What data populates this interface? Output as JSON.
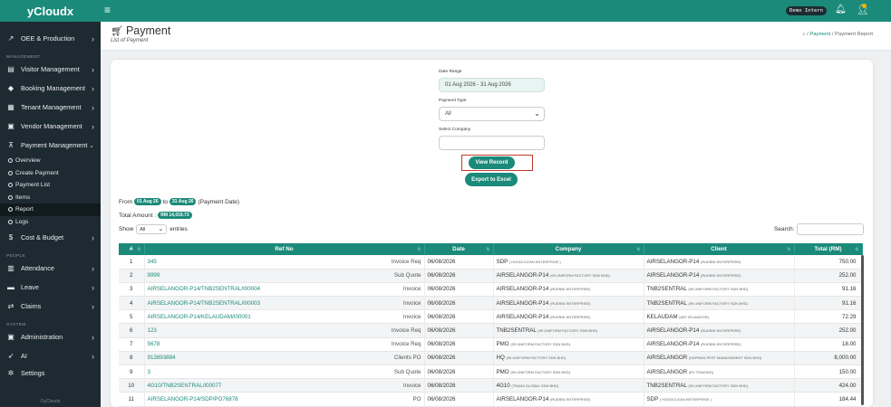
{
  "sidebar": {
    "brand": "yCloudx",
    "items": [
      {
        "label": "OEE & Production"
      },
      {
        "label": "Visitor Management"
      },
      {
        "label": "Booking Management"
      },
      {
        "label": "Tenant Management"
      },
      {
        "label": "Vendor Management"
      },
      {
        "label": "Payment Management"
      },
      {
        "label": "Cost & Budget"
      },
      {
        "label": "Attendance"
      },
      {
        "label": "Leave"
      },
      {
        "label": "Claims"
      },
      {
        "label": "Administration"
      },
      {
        "label": "AI"
      },
      {
        "label": "Settings"
      }
    ],
    "sections": {
      "management": "MANAGEMENT",
      "people": "PEOPLE",
      "system": "SYSTEM"
    },
    "payment_sub": [
      {
        "label": "Overview"
      },
      {
        "label": "Create Payment"
      },
      {
        "label": "Payment List"
      },
      {
        "label": "Items"
      },
      {
        "label": "Report"
      },
      {
        "label": "Logs"
      }
    ],
    "footer": "©yCloudx"
  },
  "topbar": {
    "env_badge": "Demo Intern"
  },
  "header": {
    "title": "Payment",
    "subtitle": "List of Payment",
    "breadcrumb": {
      "sep": "/",
      "payment": "Payment",
      "current": "Payment Report"
    }
  },
  "filters": {
    "date_range_label": "Date Range",
    "date_range_value": "01 Aug 2026 - 31 Aug 2026",
    "payment_type_label": "Payment Type",
    "payment_type_value": "All",
    "company_label": "Select Company",
    "company_value": "",
    "view_btn": "View Record",
    "export_btn": "Export to Excel"
  },
  "summary": {
    "from_label": "From",
    "from_date": "01 Aug 26",
    "to_label": "to",
    "to_date": "31 Aug 26",
    "suffix": "(Payment Date)",
    "total_label": "Total Amount :",
    "total_value": "RM 14,019.73"
  },
  "list_controls": {
    "show_label": "Show",
    "entries_value": "All",
    "entries_label": "entries",
    "search_label": "Search:"
  },
  "table": {
    "headers": [
      "#",
      "Ref No",
      "Date",
      "Company",
      "Client",
      "Total (RM)"
    ],
    "rows": [
      {
        "no": "1",
        "ref": "345",
        "type": "Invoice Req",
        "date": "06/08/2026",
        "company": "SDP",
        "company_sub": "( HOODCLEAN ENTERPRISE )",
        "client": "AIRSELANGOR-P14",
        "client_sub": "(RUEBNI ENTERPRISE)",
        "total": "750.00"
      },
      {
        "no": "2",
        "ref": "9999",
        "type": "Sub Quote",
        "date": "06/08/2026",
        "company": "AIRSELANGOR-P14",
        "company_sub": "(99 UNIFORM FACTORY SDN BHD)",
        "client": "AIRSELANGOR-P14",
        "client_sub": "(RUEBNI ENTERPRISE)",
        "total": "252.00"
      },
      {
        "no": "3",
        "ref": "AIRSELANGOR-P14/TNB2SENTRAL/I00004",
        "type": "Invoice",
        "date": "06/08/2026",
        "company": "AIRSELANGOR-P14",
        "company_sub": "(RUEBNI ENTERPRISE)",
        "client": "TNB2SENTRAL",
        "client_sub": "(99 UNIFORM FACTORY SDN BHD)",
        "total": "91.16"
      },
      {
        "no": "4",
        "ref": "AIRSELANGOR-P14/TNB2SENTRAL/I00003",
        "type": "Invoice",
        "date": "06/08/2026",
        "company": "AIRSELANGOR-P14",
        "company_sub": "(RUEBNI ENTERPRISE)",
        "client": "TNB2SENTRAL",
        "client_sub": "(99 UNIFORM FACTORY SDN BHD)",
        "total": "91.16"
      },
      {
        "no": "5",
        "ref": "AIRSELANGOR-P14/KELAUDAM/I00001",
        "type": "Invoice",
        "date": "06/08/2026",
        "company": "AIRSELANGOR-P14",
        "company_sub": "(RUEBNI ENTERPRISE)",
        "client": "KELAUDAM",
        "client_sub": "(AIR SELANGOR)",
        "total": "72.29"
      },
      {
        "no": "6",
        "ref": "123",
        "type": "Invoice Req",
        "date": "06/08/2026",
        "company": "TNB2SENTRAL",
        "company_sub": "(99 UNIFORM FACTORY SDN BHD)",
        "client": "AIRSELANGOR-P14",
        "client_sub": "(RUEBNI ENTERPRISE)",
        "total": "252.00"
      },
      {
        "no": "7",
        "ref": "5678",
        "type": "Invoice Req",
        "date": "06/08/2026",
        "company": "PMO",
        "company_sub": "(99 UNIFORM FACTORY SDN BHD)",
        "client": "AIRSELANGOR-P14",
        "client_sub": "(RUEBNI ENTERPRISE)",
        "total": "18.00"
      },
      {
        "no": "8",
        "ref": "913893884",
        "type": "Clients PO",
        "date": "06/08/2026",
        "company": "HQ",
        "company_sub": "(99 UNIFORM FACTORY SDN BHD)",
        "client": "AIRSELANGOR",
        "client_sub": "(SAPWAN PEST MANAGEMENT SDN BHD)",
        "total": "8,000.00"
      },
      {
        "no": "9",
        "ref": "3",
        "type": "Sub Quote",
        "date": "06/08/2026",
        "company": "PMO",
        "company_sub": "(99 UNIFORM FACTORY SDN BHD)",
        "client": "AIRSELANGOR",
        "client_sub": "(RV TRADING)",
        "total": "150.00"
      },
      {
        "no": "10",
        "ref": "4G10/TNB2SENTRAL/I00077",
        "type": "Invoice",
        "date": "06/08/2026",
        "company": "4G10",
        "company_sub": "(TINADI GLOBAL SDN BHD)",
        "client": "TNB2SENTRAL",
        "client_sub": "(99 UNIFORM FACTORY SDN BHD)",
        "total": "424.00"
      },
      {
        "no": "11",
        "ref": "AIRSELANGOR-P14/SDP/PO76878",
        "type": "PO",
        "date": "06/08/2026",
        "company": "AIRSELANGOR-P14",
        "company_sub": "(RUEBNI ENTERPRISE)",
        "client": "SDP",
        "client_sub": "( HOODCLEAN ENTERPRISE )",
        "total": "184.44"
      }
    ]
  },
  "colors": {
    "accent": "#1b8a7a",
    "sidebar": "#1e2a31",
    "highlight_frame": "#c0392b"
  }
}
